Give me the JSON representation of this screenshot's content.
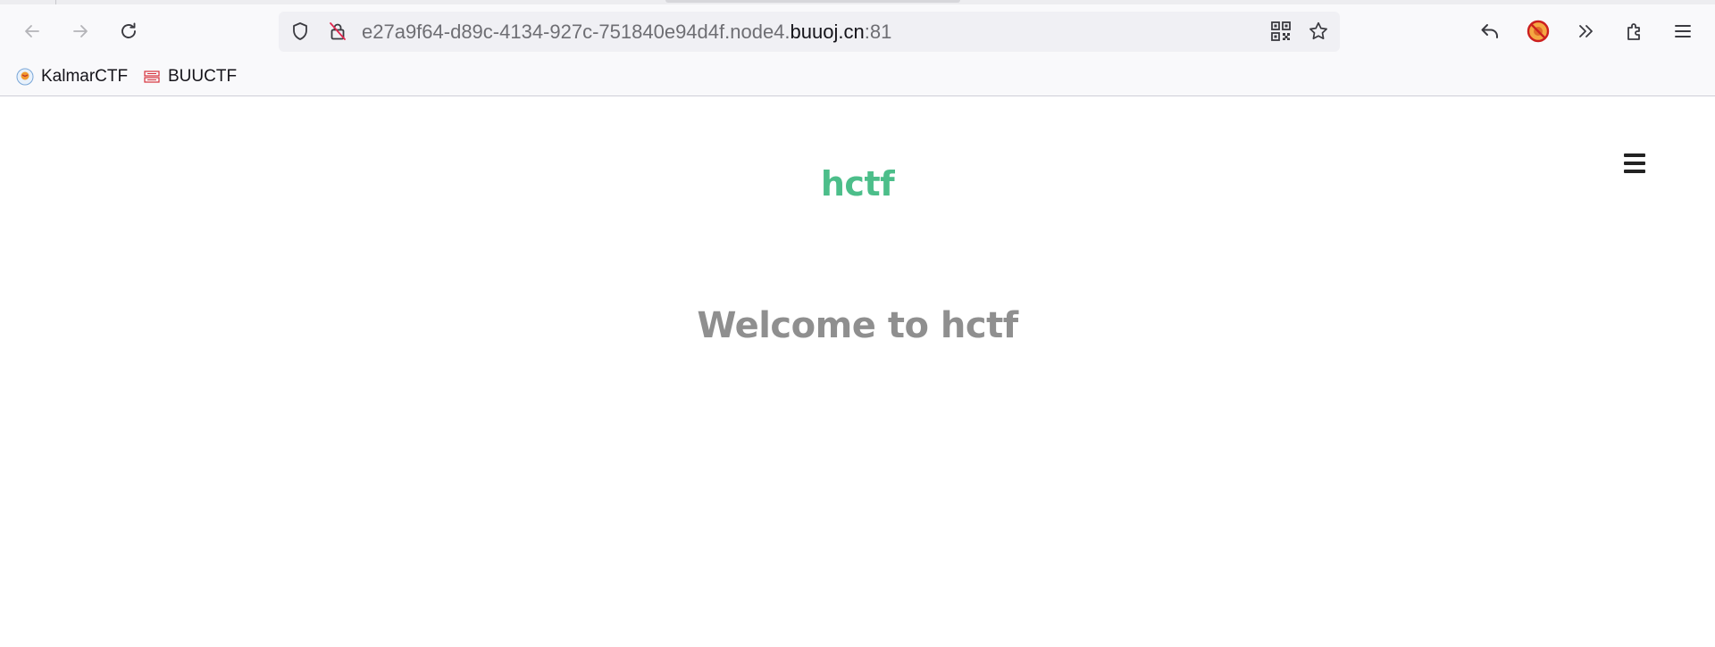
{
  "browser": {
    "url": {
      "prefix": "e27a9f64-d89c-4134-927c-751840e94d4f.node4.",
      "host": "buuoj.cn",
      "suffix": ":81"
    },
    "toolbar_icons": [
      "back-icon",
      "forward-icon",
      "reload-icon",
      "shield-icon",
      "insecure-lock-icon",
      "qr-code-icon",
      "bookmark-star-icon",
      "undo-icon",
      "blocked-addon-icon",
      "overflow-chevron-icon",
      "extensions-icon",
      "app-menu-icon"
    ],
    "bookmarks": [
      {
        "label": "KalmarCTF",
        "icon": "kalmarctf-favicon"
      },
      {
        "label": "BUUCTF",
        "icon": "buuctf-favicon"
      }
    ]
  },
  "page": {
    "site_title": "hctf",
    "welcome": "Welcome to hctf"
  },
  "colors": {
    "accent_green": "#4cbe8a",
    "welcome_gray": "#8f8f8f",
    "toolbar_bg": "#f9f9fb",
    "urlbar_bg": "#f0f0f4"
  }
}
